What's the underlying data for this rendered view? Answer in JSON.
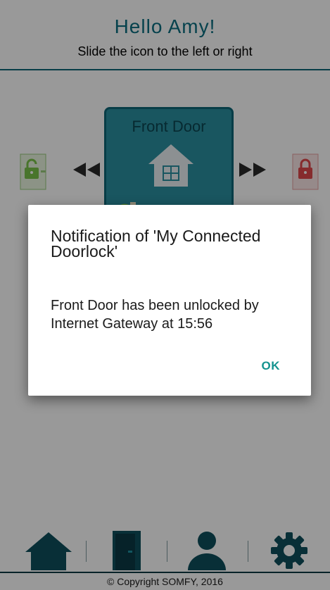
{
  "header": {
    "greeting": "Hello Amy!",
    "instruction": "Slide the icon to the left or right"
  },
  "door": {
    "name": "Front Door"
  },
  "dialog": {
    "title": "Notification of 'My Connected Doorlock'",
    "message": "Front Door has been unlocked by Internet Gateway at 15:56",
    "ok_label": "OK"
  },
  "nav": {
    "items": [
      "home-icon",
      "door-icon",
      "user-icon",
      "gear-icon"
    ]
  },
  "footer": {
    "copyright": "© Copyright SOMFY, 2016"
  },
  "colors": {
    "brand": "#0e6677",
    "accent": "#14938f",
    "unlock_green": "#7bc34a",
    "lock_red": "#e0484b"
  }
}
